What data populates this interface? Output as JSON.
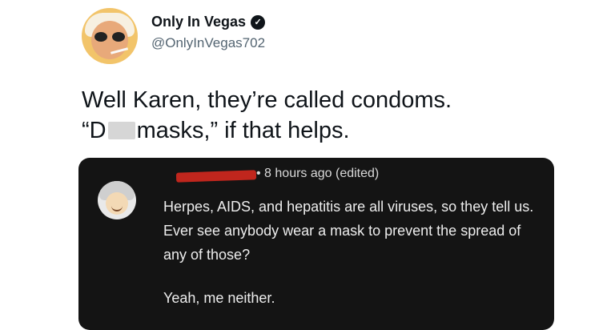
{
  "author": {
    "display_name": "Only In Vegas",
    "handle": "@OnlyInVegas702",
    "verified_glyph": "✓"
  },
  "tweet": {
    "line1": "Well Karen, they’re called condoms.",
    "line2_start": "“D",
    "line2_end": "masks,” if that helps."
  },
  "embedded_comment": {
    "meta": "• 8 hours ago (edited)",
    "body": "Herpes, AIDS, and hepatitis are all viruses, so they tell us. Ever see anybody wear a mask to prevent the spread of any of those?",
    "followup": "Yeah, me neither."
  },
  "colors": {
    "embed_background": "#141414",
    "redaction": "#c0261d"
  }
}
